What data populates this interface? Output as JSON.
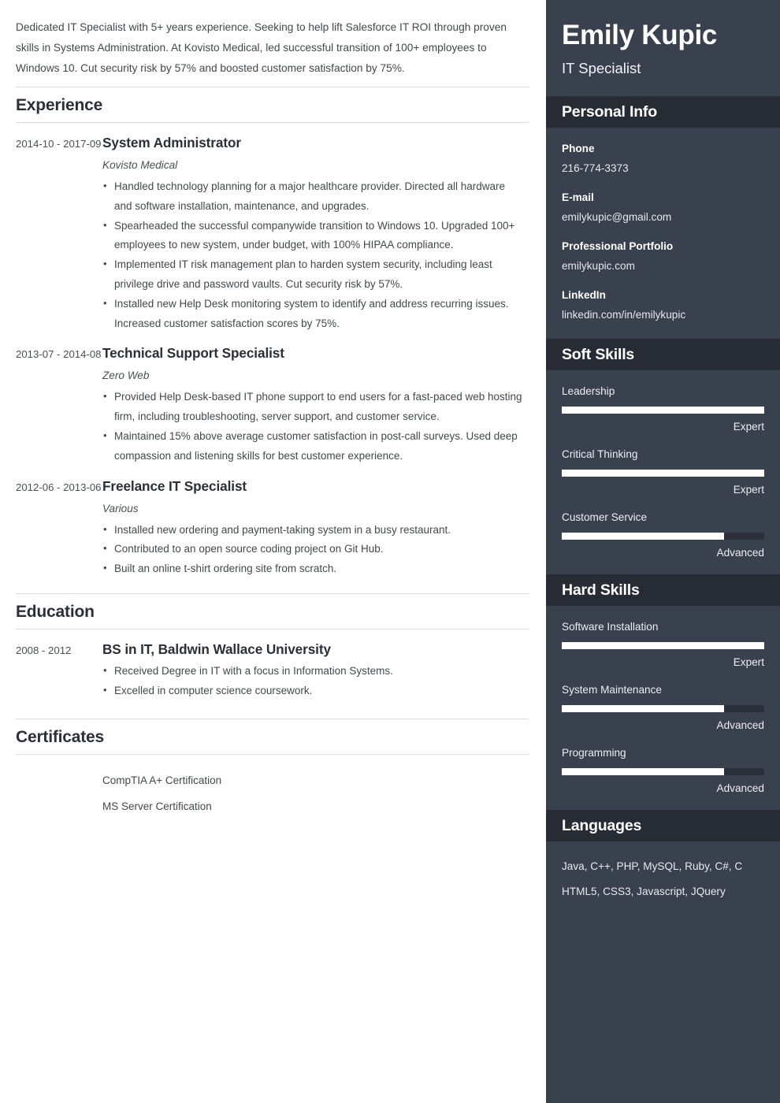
{
  "summary": "Dedicated IT Specialist with 5+ years experience. Seeking to help lift Salesforce IT ROI through proven skills in Systems Administration. At Kovisto Medical, led successful transition of 100+ employees to Windows 10. Cut security risk by 57% and boosted customer satisfaction by 75%.",
  "sections": {
    "experience_title": "Experience",
    "education_title": "Education",
    "certificates_title": "Certificates"
  },
  "experience": [
    {
      "dates": "2014-10 - 2017-09",
      "title": "System Administrator",
      "company": "Kovisto Medical",
      "bullets": [
        "Handled technology planning for a major healthcare provider. Directed all hardware and software installation, maintenance, and upgrades.",
        "Spearheaded the successful companywide transition to Windows 10. Upgraded 100+ employees to new system, under budget, with 100% HIPAA compliance.",
        "Implemented IT risk management plan to harden system security, including least privilege drive and password vaults. Cut security risk by 57%.",
        "Installed new Help Desk monitoring system to identify and address recurring issues. Increased customer satisfaction scores by 75%."
      ]
    },
    {
      "dates": "2013-07 - 2014-08",
      "title": "Technical Support Specialist",
      "company": "Zero Web",
      "bullets": [
        "Provided Help Desk-based IT phone support to end users for a fast-paced web hosting firm, including troubleshooting, server support, and customer service.",
        "Maintained 15% above average customer satisfaction in post-call surveys. Used deep compassion and listening skills for best customer experience."
      ]
    },
    {
      "dates": "2012-06 - 2013-06",
      "title": "Freelance IT Specialist",
      "company": "Various",
      "bullets": [
        "Installed new ordering and payment-taking system in a busy restaurant.",
        "Contributed to an open source coding project on Git Hub.",
        "Built an online t-shirt ordering site from scratch."
      ]
    }
  ],
  "education": [
    {
      "dates": "2008 - 2012",
      "title": "BS in IT, Baldwin Wallace University",
      "bullets": [
        "Received Degree in IT with a focus in Information Systems.",
        "Excelled in computer science coursework."
      ]
    }
  ],
  "certificates": [
    "CompTIA A+ Certification",
    "MS Server Certification"
  ],
  "sidebar": {
    "name": "Emily Kupic",
    "role": "IT Specialist",
    "personal_info": {
      "heading": "Personal Info",
      "items": [
        {
          "label": "Phone",
          "value": "216-774-3373"
        },
        {
          "label": "E-mail",
          "value": "emilykupic@gmail.com"
        },
        {
          "label": "Professional Portfolio",
          "value": "emilykupic.com"
        },
        {
          "label": "LinkedIn",
          "value": "linkedin.com/in/emilykupic"
        }
      ]
    },
    "soft_skills": {
      "heading": "Soft Skills",
      "items": [
        {
          "name": "Leadership",
          "level": "Expert",
          "percent": 100
        },
        {
          "name": "Critical Thinking",
          "level": "Expert",
          "percent": 100
        },
        {
          "name": "Customer Service",
          "level": "Advanced",
          "percent": 80
        }
      ]
    },
    "hard_skills": {
      "heading": "Hard Skills",
      "items": [
        {
          "name": "Software Installation",
          "level": "Expert",
          "percent": 100
        },
        {
          "name": "System Maintenance",
          "level": "Advanced",
          "percent": 80
        },
        {
          "name": "Programming",
          "level": "Advanced",
          "percent": 80
        }
      ]
    },
    "languages": {
      "heading": "Languages",
      "lines": [
        "Java, C++, PHP, MySQL, Ruby, C#, C",
        "HTML5, CSS3, Javascript, JQuery"
      ]
    }
  },
  "colors": {
    "sidebar_bg": "#39404e",
    "sidebar_header_bg": "#272b34",
    "bar_fill": "#ffffff",
    "bar_track": "#2b303b",
    "text_dark": "#2b2f38",
    "rule": "#dcdddf"
  }
}
